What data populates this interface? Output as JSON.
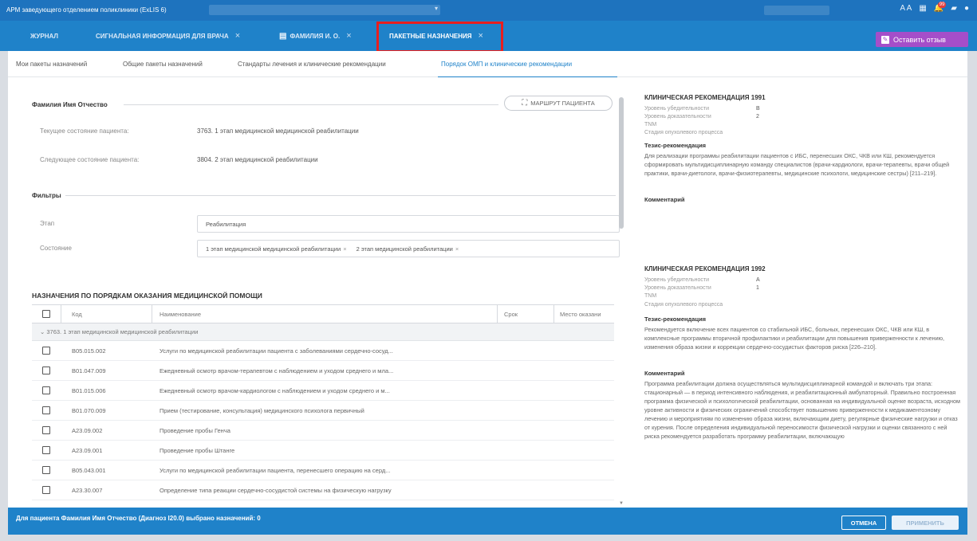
{
  "titlebar": {
    "app_title": "АРМ заведующего отделением поликлиники (ExLIS 6)",
    "icons": [
      "font-size-icon",
      "grid-icon",
      "bell-icon",
      "chat-icon",
      "help-icon"
    ],
    "font_size_text": "A A",
    "bell_badge": "99"
  },
  "tabs": [
    {
      "label": "Журнал",
      "closable": false
    },
    {
      "label": "Сигнальная информация для врача",
      "closable": true
    },
    {
      "label": "Фамилия И. О.",
      "closable": true
    },
    {
      "label": "Пакетные назначения",
      "closable": true,
      "active": true
    }
  ],
  "feedback_label": "Оставить отзыв",
  "subtabs": [
    {
      "label": "Мои пакеты назначений"
    },
    {
      "label": "Общие пакеты назначений"
    },
    {
      "label": "Стандарты лечения и клинические рекомендации"
    },
    {
      "label": "Порядок ОМП и клинические рекомендации",
      "active": true
    }
  ],
  "patient": {
    "name": "Фамилия Имя Отчество",
    "route_button": "МАРШРУТ ПАЦИЕНТА",
    "current_state_label": "Текущее состояние пациента:",
    "current_state_value": "3763. 1 этап медицинской медицинской реабилитации",
    "next_state_label": "Следующее состояние пациента:",
    "next_state_value": "3804. 2 этап медицинской реабилитации"
  },
  "filters": {
    "title": "Фильтры",
    "stage_label": "Этап",
    "stage_value": "Реабилитация",
    "state_label": "Состояние",
    "state_chips": [
      "1 этап медицинской медицинской реабилитации",
      "2 этап медицинской реабилитации"
    ]
  },
  "table": {
    "title": "НАЗНАЧЕНИЯ ПО ПОРЯДКАМ ОКАЗАНИЯ МЕДИЦИНСКОЙ ПОМОЩИ",
    "columns": [
      "Код",
      "Наименование",
      "Срок",
      "Место оказани"
    ],
    "group": "3763. 1 этап медицинской медицинской реабилитации",
    "rows": [
      {
        "code": "B05.015.002",
        "name": "Услуги по медицинской реабилитации пациента с заболеваниями сердечно-сосуд..."
      },
      {
        "code": "B01.047.009",
        "name": "Ежедневный осмотр врачом-терапевтом с наблюдением и уходом среднего и мла..."
      },
      {
        "code": "B01.015.006",
        "name": "Ежедневный осмотр врачом-кардиологом с наблюдением и уходом среднего и м..."
      },
      {
        "code": "B01.070.009",
        "name": "Прием (тестирование, консультация) медицинского психолога первичный"
      },
      {
        "code": "A23.09.002",
        "name": "Проведение пробы Генча"
      },
      {
        "code": "A23.09.001",
        "name": "Проведение пробы Штанге"
      },
      {
        "code": "B05.043.001",
        "name": "Услуги по медицинской реабилитации пациента, перенесшего операцию на серд..."
      },
      {
        "code": "A23.30.007",
        "name": "Определение типа реакции сердечно-сосудистой системы на физическую нагрузку"
      }
    ]
  },
  "recommendations": [
    {
      "title": "КЛИНИЧЕСКАЯ РЕКОМЕНДАЦИЯ 1991",
      "persuasion_label": "Уровень убедительности",
      "persuasion_value": "B",
      "evidence_label": "Уровень доказательности",
      "evidence_value": "2",
      "tnm_label": "TNM",
      "stage_label": "Стадия опухолевого процесса",
      "thesis_label": "Тезис-рекомендация",
      "thesis": "Для реализации программы реабилитации пациентов с ИБС, перенесших ОКС, ЧКВ или КШ, рекомендуется сформировать мультидисциплинарную команду специалистов (врачи-кардиологи, врачи-терапевты, врачи общей практики, врачи-диетологи, врачи-физиотерапевты, медицинские психологи, медицинские сестры) [211–219].",
      "comment_label": "Комментарий",
      "comment": ""
    },
    {
      "title": "КЛИНИЧЕСКАЯ РЕКОМЕНДАЦИЯ 1992",
      "persuasion_label": "Уровень убедительности",
      "persuasion_value": "A",
      "evidence_label": "Уровень доказательности",
      "evidence_value": "1",
      "tnm_label": "TNM",
      "stage_label": "Стадия опухолевого процесса",
      "thesis_label": "Тезис-рекомендация",
      "thesis": "Рекомендуется включение всех пациентов со стабильной ИБС, больных, перенесших ОКС, ЧКВ или КШ, в комплексные программы вторичной профилактики и реабилитации для повышения приверженности к лечению, изменения образа жизни и коррекции сердечно-сосудистых факторов риска [226–210].",
      "comment_label": "Комментарий",
      "comment": "Программа реабилитации должна осуществляться мультидисциплинарной командой и включать три этапа: стационарный — в период интенсивного наблюдения, и реабилитационный амбулаторный. Правильно построенная программа физической и психологической реабилитации, основанная на индивидуальной оценке возраста, исходном уровне активности и физических ограничений способствует повышению приверженности к медикаментозному лечению и мероприятиям по изменению образа жизни, включающим диету, регулярные физические нагрузки и отказ от курения. После определения индивидуальной переносимости физической нагрузки и оценки связанного с ней риска рекомендуется разработать программу реабилитации, включающую"
    }
  ],
  "footer": {
    "text": "Для пациента Фамилия Имя Отчество (Диагноз I20.0) выбрано назначений: 0",
    "cancel": "ОТМЕНА",
    "apply": "ПРИМЕНИТЬ"
  }
}
